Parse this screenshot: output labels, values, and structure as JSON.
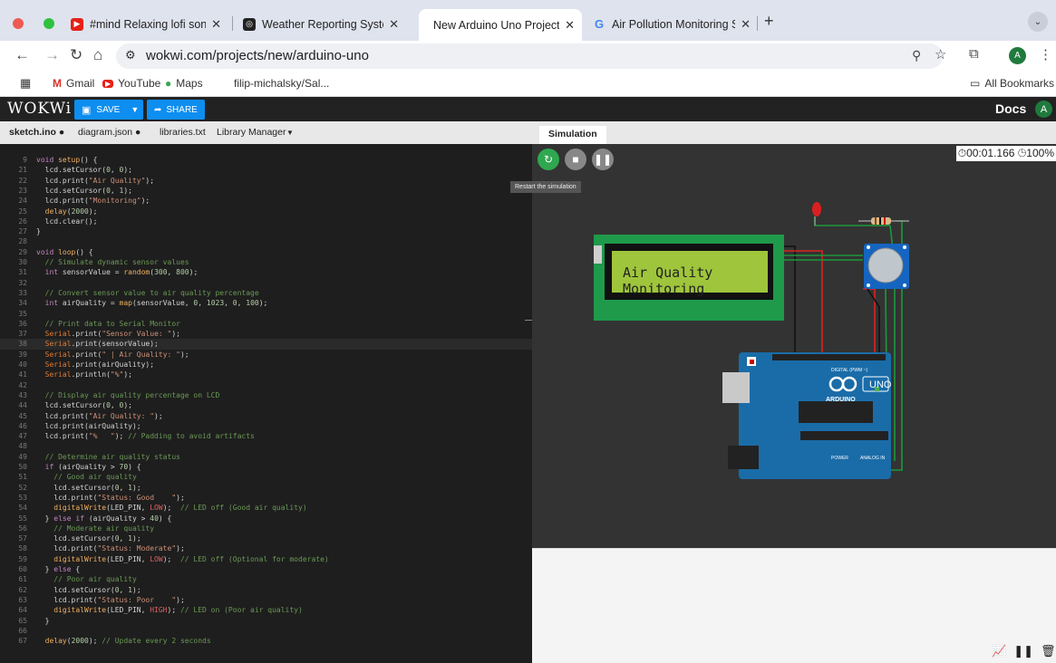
{
  "browser": {
    "tabs": [
      {
        "title": "#mind Relaxing lofi song # lo",
        "icon": "youtube-icon",
        "color": "#e62117"
      },
      {
        "title": "Weather Reporting System C",
        "icon": "chatgpt-icon",
        "color": "#222222"
      },
      {
        "title": "New Arduino Uno Project - W",
        "icon": "none",
        "color": "#ffffff"
      },
      {
        "title": "Air Pollution Monitoring Syste",
        "icon": "google-icon",
        "color": "#4285f4"
      }
    ],
    "url": "wokwi.com/projects/new/arduino-uno",
    "bookmarks": [
      "Gmail",
      "YouTube",
      "Maps",
      "filip-michalsky/Sal..."
    ],
    "all_bookmarks": "All Bookmarks",
    "profile_initial": "A"
  },
  "app": {
    "logo": "WOKWi",
    "save_label": "SAVE",
    "share_label": "SHARE",
    "docs_label": "Docs",
    "user_initial": "A"
  },
  "editor": {
    "tabs": [
      "sketch.ino ●",
      "diagram.json ●",
      "libraries.txt",
      "Library Manager"
    ],
    "lines": [
      {
        "n": "9",
        "t": "void setup() {"
      },
      {
        "n": "21",
        "t": "  lcd.setCursor(0, 0);"
      },
      {
        "n": "22",
        "t": "  lcd.print(\"Air Quality\");"
      },
      {
        "n": "23",
        "t": "  lcd.setCursor(0, 1);"
      },
      {
        "n": "24",
        "t": "  lcd.print(\"Monitoring\");"
      },
      {
        "n": "25",
        "t": "  delay(2000);"
      },
      {
        "n": "26",
        "t": "  lcd.clear();"
      },
      {
        "n": "27",
        "t": "}"
      },
      {
        "n": "28",
        "t": ""
      },
      {
        "n": "29",
        "t": "void loop() {"
      },
      {
        "n": "30",
        "t": "  // Simulate dynamic sensor values"
      },
      {
        "n": "31",
        "t": "  int sensorValue = random(300, 800);"
      },
      {
        "n": "32",
        "t": ""
      },
      {
        "n": "33",
        "t": "  // Convert sensor value to air quality percentage"
      },
      {
        "n": "34",
        "t": "  int airQuality = map(sensorValue, 0, 1023, 0, 100);"
      },
      {
        "n": "35",
        "t": ""
      },
      {
        "n": "36",
        "t": "  // Print data to Serial Monitor"
      },
      {
        "n": "37",
        "t": "  Serial.print(\"Sensor Value: \");"
      },
      {
        "n": "38",
        "t": "  Serial.print(sensorValue);"
      },
      {
        "n": "39",
        "t": "  Serial.print(\" | Air Quality: \");"
      },
      {
        "n": "40",
        "t": "  Serial.print(airQuality);"
      },
      {
        "n": "41",
        "t": "  Serial.println(\"%\");"
      },
      {
        "n": "42",
        "t": ""
      },
      {
        "n": "43",
        "t": "  // Display air quality percentage on LCD"
      },
      {
        "n": "44",
        "t": "  lcd.setCursor(0, 0);"
      },
      {
        "n": "45",
        "t": "  lcd.print(\"Air Quality: \");"
      },
      {
        "n": "46",
        "t": "  lcd.print(airQuality);"
      },
      {
        "n": "47",
        "t": "  lcd.print(\"%   \"); // Padding to avoid artifacts"
      },
      {
        "n": "48",
        "t": ""
      },
      {
        "n": "49",
        "t": "  // Determine air quality status"
      },
      {
        "n": "50",
        "t": "  if (airQuality > 70) {"
      },
      {
        "n": "51",
        "t": "    // Good air quality"
      },
      {
        "n": "52",
        "t": "    lcd.setCursor(0, 1);"
      },
      {
        "n": "53",
        "t": "    lcd.print(\"Status: Good    \");"
      },
      {
        "n": "54",
        "t": "    digitalWrite(LED_PIN, LOW);  // LED off (Good air quality)"
      },
      {
        "n": "55",
        "t": "  } else if (airQuality > 40) {"
      },
      {
        "n": "56",
        "t": "    // Moderate air quality"
      },
      {
        "n": "57",
        "t": "    lcd.setCursor(0, 1);"
      },
      {
        "n": "58",
        "t": "    lcd.print(\"Status: Moderate\");"
      },
      {
        "n": "59",
        "t": "    digitalWrite(LED_PIN, LOW);  // LED off (Optional for moderate)"
      },
      {
        "n": "60",
        "t": "  } else {"
      },
      {
        "n": "61",
        "t": "    // Poor air quality"
      },
      {
        "n": "62",
        "t": "    lcd.setCursor(0, 1);"
      },
      {
        "n": "63",
        "t": "    lcd.print(\"Status: Poor    \");"
      },
      {
        "n": "64",
        "t": "    digitalWrite(LED_PIN, HIGH); // LED on (Poor air quality)"
      },
      {
        "n": "65",
        "t": "  }"
      },
      {
        "n": "66",
        "t": ""
      },
      {
        "n": "67",
        "t": "  delay(2000); // Update every 2 seconds"
      }
    ]
  },
  "simulation": {
    "tab_label": "Simulation",
    "timer": "00:01.166",
    "speed": "100%",
    "tooltip": "Restart the simulation",
    "lcd_line1": "Air Quality",
    "lcd_line2": "Monitoring",
    "board_label": "UNO",
    "board_brand": "ARDUINO",
    "digital_label": "DIGITAL (PWM ~)",
    "power_label": "POWER",
    "analog_label": "ANALOG IN"
  }
}
